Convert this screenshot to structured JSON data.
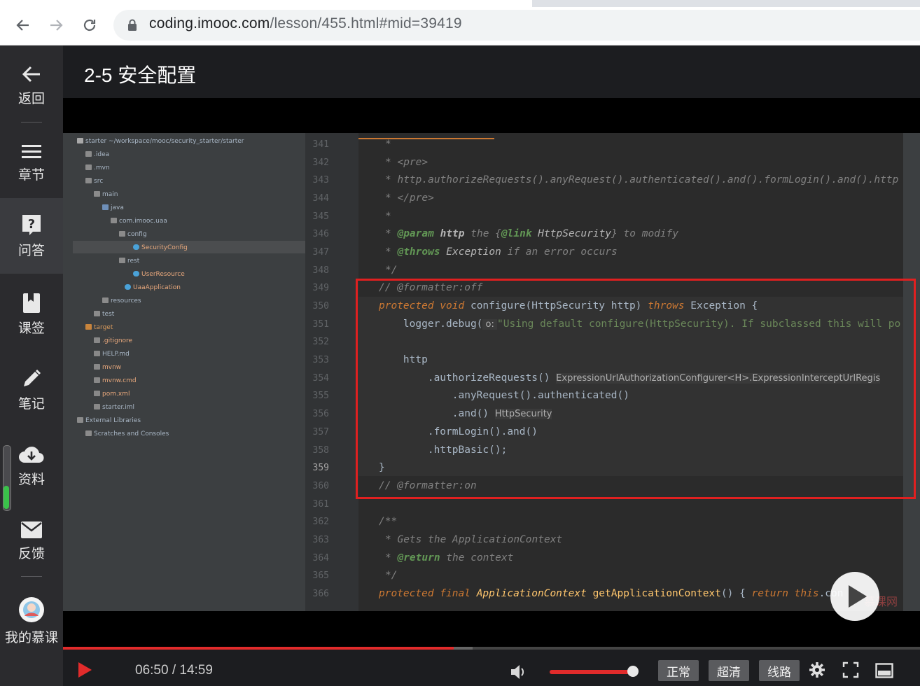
{
  "browser": {
    "url_host": "coding.imooc.com",
    "url_path": "/lesson/455.html#mid=39419"
  },
  "sidebar": {
    "items": [
      {
        "label": "返回",
        "icon": "back-arrow-icon"
      },
      {
        "label": "章节",
        "icon": "menu-icon"
      },
      {
        "label": "问答",
        "icon": "question-icon"
      },
      {
        "label": "课签",
        "icon": "bookmark-icon"
      },
      {
        "label": "笔记",
        "icon": "pencil-icon"
      },
      {
        "label": "资料",
        "icon": "cloud-download-icon"
      },
      {
        "label": "反馈",
        "icon": "mail-icon"
      },
      {
        "label": "我的慕课",
        "icon": "avatar"
      }
    ]
  },
  "lesson": {
    "title": "2-5 安全配置"
  },
  "ide": {
    "project_tree": [
      "starter ~/workspace/mooc/security_starter/starter",
      ".idea",
      ".mvn",
      "src",
      "main",
      "java",
      "com.imooc.uaa",
      "config",
      "SecurityConfig",
      "rest",
      "UserResource",
      "UaaApplication",
      "resources",
      "test",
      "target",
      ".gitignore",
      "HELP.md",
      "mvnw",
      "mvnw.cmd",
      "pom.xml",
      "starter.iml",
      "External Libraries",
      "Scratches and Consoles"
    ],
    "line_numbers": [
      "341",
      "342",
      "343",
      "344",
      "345",
      "346",
      "347",
      "348",
      "349",
      "350",
      "351",
      "352",
      "353",
      "354",
      "355",
      "356",
      "357",
      "358",
      "359",
      "360",
      "361",
      "362",
      "363",
      "364",
      "365",
      "366"
    ],
    "code": {
      "l341": "*",
      "l342_a": "* ",
      "l342_b": "<pre>",
      "l343": "* http.authorizeRequests().anyRequest().authenticated().and().formLogin().and().http",
      "l344_a": "* ",
      "l344_b": "</pre>",
      "l345": "*",
      "l346_a": "* ",
      "l346_b": "@param",
      "l346_c": " http",
      "l346_d": " the {",
      "l346_e": "@link",
      "l346_f": " HttpSecurity",
      "l346_g": "} to modify",
      "l347_a": "* ",
      "l347_b": "@throws",
      "l347_c": " Exception",
      "l347_d": " if an error occurs",
      "l348": "*/",
      "l349": "// @formatter:off",
      "l350_a": "protected",
      "l350_b": " void ",
      "l350_c": "configure(HttpSecurity http) ",
      "l350_d": "throws",
      "l350_e": " Exception {",
      "l351_a": "    logger.debug(",
      "l351_b": " o: ",
      "l351_c": "\"Using default configure(HttpSecurity). If subclassed this will po",
      "l353": "    http",
      "l354_a": "        .authorizeRequests() ",
      "l354_b": "ExpressionUrlAuthorizationConfigurer<H>.ExpressionInterceptUrlRegis",
      "l355": "            .anyRequest().authenticated()",
      "l356_a": "            .and() ",
      "l356_b": "HttpSecurity",
      "l357": "        .formLogin().and()",
      "l358": "        .httpBasic();",
      "l359": "}",
      "l360": "// @formatter:on",
      "l362": "/**",
      "l363": "* Gets the ApplicationContext",
      "l364_a": "* ",
      "l364_b": "@return",
      "l364_c": " the context",
      "l365": "*/",
      "l366_a": "protected final ",
      "l366_b": "ApplicationContext ",
      "l366_c": "getApplicationContext",
      "l366_d": "() { ",
      "l366_e": "return this",
      "l366_f": ".con"
    },
    "watermark": "慕课网"
  },
  "player": {
    "current_time": "06:50",
    "separator": " / ",
    "duration": "14:59",
    "progress_fraction": 0.456,
    "quality_normal": "正常",
    "quality_hd": "超清",
    "route": "线路"
  }
}
